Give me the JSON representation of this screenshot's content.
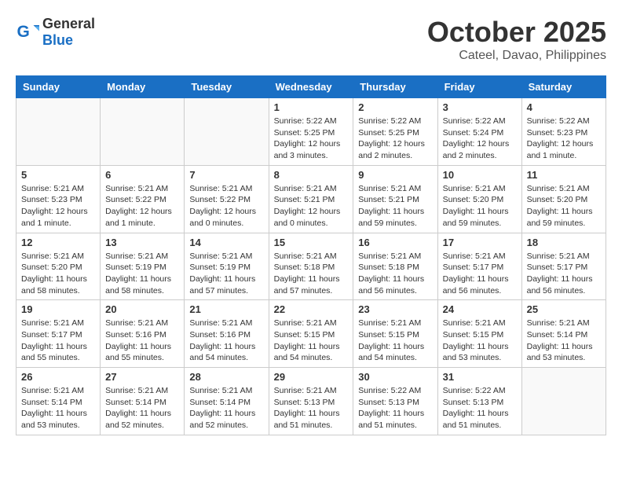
{
  "header": {
    "logo_general": "General",
    "logo_blue": "Blue",
    "month_year": "October 2025",
    "location": "Cateel, Davao, Philippines"
  },
  "calendar": {
    "weekdays": [
      "Sunday",
      "Monday",
      "Tuesday",
      "Wednesday",
      "Thursday",
      "Friday",
      "Saturday"
    ],
    "weeks": [
      [
        {
          "day": "",
          "info": ""
        },
        {
          "day": "",
          "info": ""
        },
        {
          "day": "",
          "info": ""
        },
        {
          "day": "1",
          "info": "Sunrise: 5:22 AM\nSunset: 5:25 PM\nDaylight: 12 hours\nand 3 minutes."
        },
        {
          "day": "2",
          "info": "Sunrise: 5:22 AM\nSunset: 5:25 PM\nDaylight: 12 hours\nand 2 minutes."
        },
        {
          "day": "3",
          "info": "Sunrise: 5:22 AM\nSunset: 5:24 PM\nDaylight: 12 hours\nand 2 minutes."
        },
        {
          "day": "4",
          "info": "Sunrise: 5:22 AM\nSunset: 5:23 PM\nDaylight: 12 hours\nand 1 minute."
        }
      ],
      [
        {
          "day": "5",
          "info": "Sunrise: 5:21 AM\nSunset: 5:23 PM\nDaylight: 12 hours\nand 1 minute."
        },
        {
          "day": "6",
          "info": "Sunrise: 5:21 AM\nSunset: 5:22 PM\nDaylight: 12 hours\nand 1 minute."
        },
        {
          "day": "7",
          "info": "Sunrise: 5:21 AM\nSunset: 5:22 PM\nDaylight: 12 hours\nand 0 minutes."
        },
        {
          "day": "8",
          "info": "Sunrise: 5:21 AM\nSunset: 5:21 PM\nDaylight: 12 hours\nand 0 minutes."
        },
        {
          "day": "9",
          "info": "Sunrise: 5:21 AM\nSunset: 5:21 PM\nDaylight: 11 hours\nand 59 minutes."
        },
        {
          "day": "10",
          "info": "Sunrise: 5:21 AM\nSunset: 5:20 PM\nDaylight: 11 hours\nand 59 minutes."
        },
        {
          "day": "11",
          "info": "Sunrise: 5:21 AM\nSunset: 5:20 PM\nDaylight: 11 hours\nand 59 minutes."
        }
      ],
      [
        {
          "day": "12",
          "info": "Sunrise: 5:21 AM\nSunset: 5:20 PM\nDaylight: 11 hours\nand 58 minutes."
        },
        {
          "day": "13",
          "info": "Sunrise: 5:21 AM\nSunset: 5:19 PM\nDaylight: 11 hours\nand 58 minutes."
        },
        {
          "day": "14",
          "info": "Sunrise: 5:21 AM\nSunset: 5:19 PM\nDaylight: 11 hours\nand 57 minutes."
        },
        {
          "day": "15",
          "info": "Sunrise: 5:21 AM\nSunset: 5:18 PM\nDaylight: 11 hours\nand 57 minutes."
        },
        {
          "day": "16",
          "info": "Sunrise: 5:21 AM\nSunset: 5:18 PM\nDaylight: 11 hours\nand 56 minutes."
        },
        {
          "day": "17",
          "info": "Sunrise: 5:21 AM\nSunset: 5:17 PM\nDaylight: 11 hours\nand 56 minutes."
        },
        {
          "day": "18",
          "info": "Sunrise: 5:21 AM\nSunset: 5:17 PM\nDaylight: 11 hours\nand 56 minutes."
        }
      ],
      [
        {
          "day": "19",
          "info": "Sunrise: 5:21 AM\nSunset: 5:17 PM\nDaylight: 11 hours\nand 55 minutes."
        },
        {
          "day": "20",
          "info": "Sunrise: 5:21 AM\nSunset: 5:16 PM\nDaylight: 11 hours\nand 55 minutes."
        },
        {
          "day": "21",
          "info": "Sunrise: 5:21 AM\nSunset: 5:16 PM\nDaylight: 11 hours\nand 54 minutes."
        },
        {
          "day": "22",
          "info": "Sunrise: 5:21 AM\nSunset: 5:15 PM\nDaylight: 11 hours\nand 54 minutes."
        },
        {
          "day": "23",
          "info": "Sunrise: 5:21 AM\nSunset: 5:15 PM\nDaylight: 11 hours\nand 54 minutes."
        },
        {
          "day": "24",
          "info": "Sunrise: 5:21 AM\nSunset: 5:15 PM\nDaylight: 11 hours\nand 53 minutes."
        },
        {
          "day": "25",
          "info": "Sunrise: 5:21 AM\nSunset: 5:14 PM\nDaylight: 11 hours\nand 53 minutes."
        }
      ],
      [
        {
          "day": "26",
          "info": "Sunrise: 5:21 AM\nSunset: 5:14 PM\nDaylight: 11 hours\nand 53 minutes."
        },
        {
          "day": "27",
          "info": "Sunrise: 5:21 AM\nSunset: 5:14 PM\nDaylight: 11 hours\nand 52 minutes."
        },
        {
          "day": "28",
          "info": "Sunrise: 5:21 AM\nSunset: 5:14 PM\nDaylight: 11 hours\nand 52 minutes."
        },
        {
          "day": "29",
          "info": "Sunrise: 5:21 AM\nSunset: 5:13 PM\nDaylight: 11 hours\nand 51 minutes."
        },
        {
          "day": "30",
          "info": "Sunrise: 5:22 AM\nSunset: 5:13 PM\nDaylight: 11 hours\nand 51 minutes."
        },
        {
          "day": "31",
          "info": "Sunrise: 5:22 AM\nSunset: 5:13 PM\nDaylight: 11 hours\nand 51 minutes."
        },
        {
          "day": "",
          "info": ""
        }
      ]
    ]
  }
}
